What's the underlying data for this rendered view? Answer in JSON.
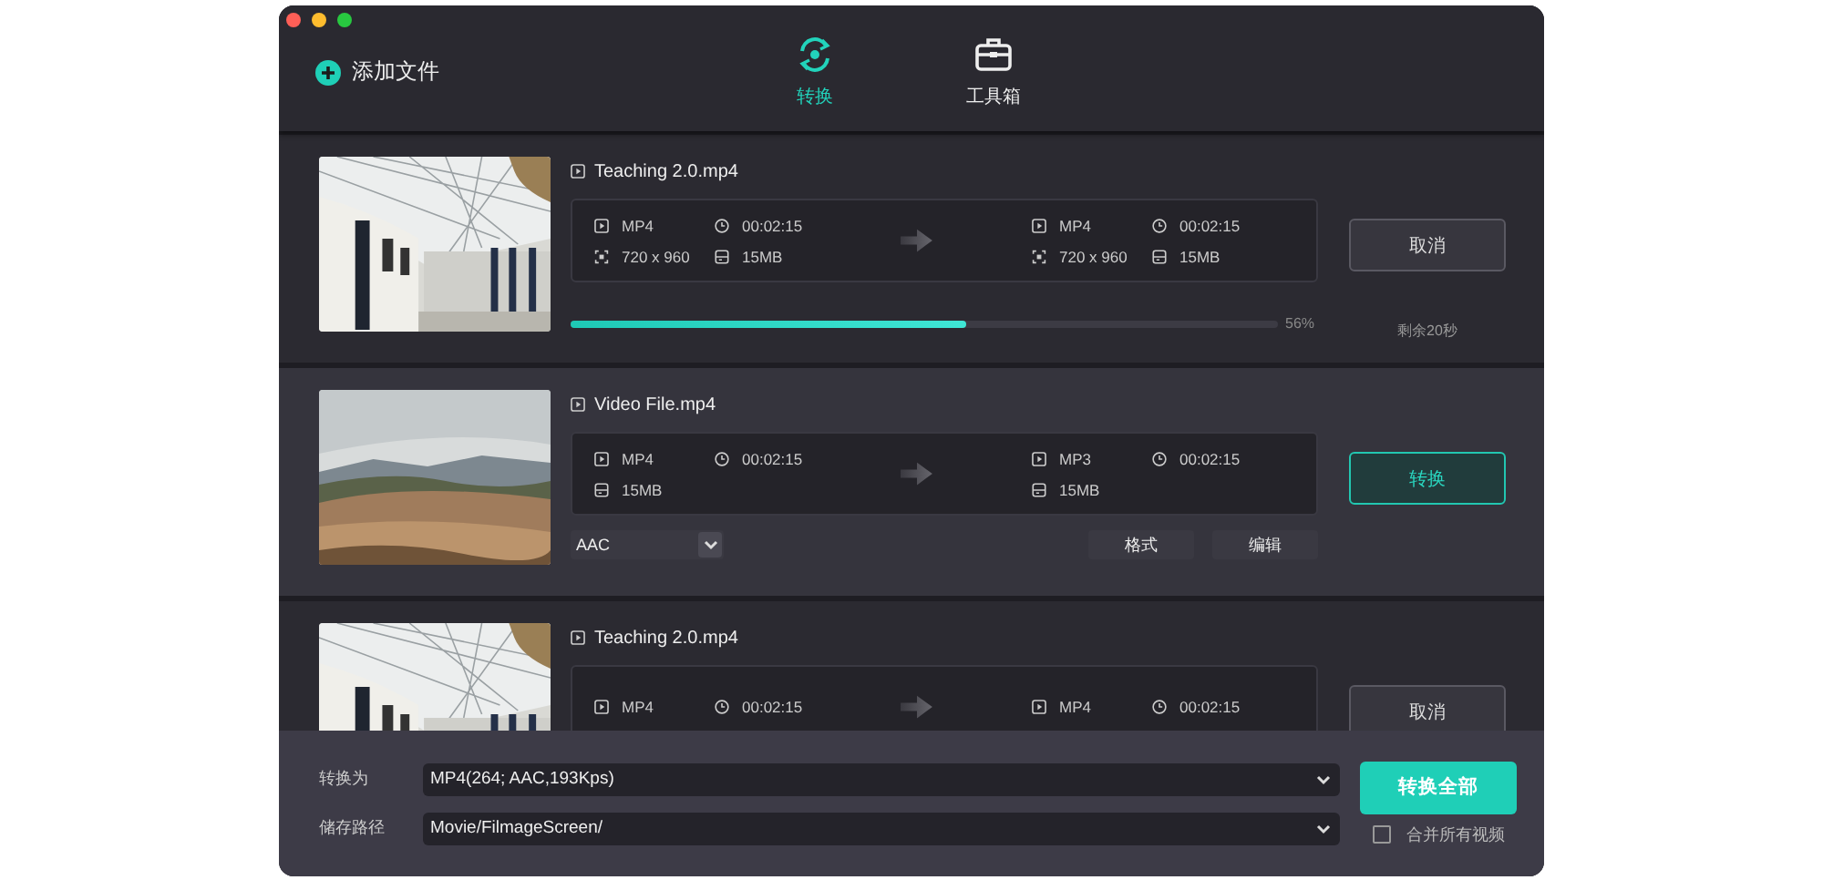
{
  "toolbar": {
    "add_button": "添加文件",
    "tabs": [
      {
        "label": "转换",
        "kind": "convert",
        "selected": true
      },
      {
        "label": "工具箱",
        "kind": "toolbox",
        "selected": false
      }
    ]
  },
  "files": [
    {
      "name": "Teaching 2.0.mp4",
      "selected": false,
      "source": [
        {
          "kind": "format",
          "text": "MP4"
        },
        {
          "kind": "duration",
          "text": "00:02:15"
        },
        {
          "kind": "resolution",
          "text": "720 x 960"
        },
        {
          "kind": "size",
          "text": "15MB"
        }
      ],
      "target": [
        {
          "kind": "format",
          "text": "MP4"
        },
        {
          "kind": "duration",
          "text": "00:02:15"
        },
        {
          "kind": "resolution",
          "text": "720 x 960"
        },
        {
          "kind": "size",
          "text": "15MB"
        }
      ],
      "progress": {
        "level": 0.56,
        "percent": "56%",
        "remaining": "剩余20秒"
      },
      "action": {
        "label": "取消",
        "kind": "cancel"
      }
    },
    {
      "name": "Video File.mp4",
      "selected": true,
      "source": [
        {
          "kind": "format",
          "text": "MP4"
        },
        {
          "kind": "duration",
          "text": "00:02:15"
        },
        {
          "kind": "size",
          "text": "15MB"
        }
      ],
      "target": [
        {
          "kind": "format",
          "text": "MP3"
        },
        {
          "kind": "duration",
          "text": "00:02:15"
        },
        {
          "kind": "size",
          "text": "15MB"
        }
      ],
      "audio_select": "AAC",
      "buttons": [
        "格式",
        "编辑"
      ],
      "action": {
        "label": "转换",
        "kind": "convert"
      }
    },
    {
      "name": "Teaching 2.0.mp4",
      "selected": false,
      "source": [
        {
          "kind": "format",
          "text": "MP4"
        },
        {
          "kind": "duration",
          "text": "00:02:15"
        }
      ],
      "target": [
        {
          "kind": "format",
          "text": "MP4"
        },
        {
          "kind": "duration",
          "text": "00:02:15"
        }
      ],
      "action": {
        "label": "取消",
        "kind": "cancel"
      }
    }
  ],
  "footer": {
    "convert_to_label": "转换为",
    "convert_to_value": "MP4(264; AAC,193Kps)",
    "save_path_label": "储存路径",
    "save_path_value": "Movie/FilmageScreen/",
    "convert_all_button": "转换全部",
    "merge_checkbox": {
      "label": "合并所有视频",
      "checked": false
    }
  }
}
